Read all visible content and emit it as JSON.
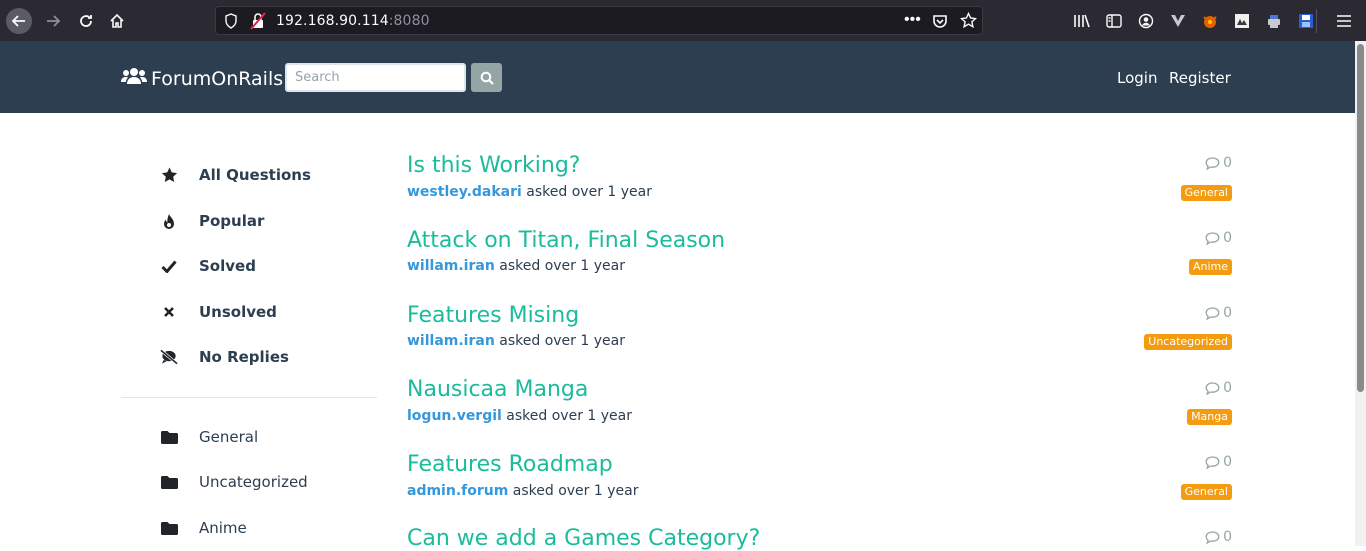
{
  "browser": {
    "url_host": "192.168.90.114",
    "url_port": ":8080"
  },
  "navbar": {
    "brand": "ForumOnRails",
    "search_placeholder": "Search",
    "login": "Login",
    "register": "Register",
    "bg_color": "#2c3e50"
  },
  "sidebar": {
    "filters": [
      {
        "label": "All Questions",
        "icon": "star-icon"
      },
      {
        "label": "Popular",
        "icon": "fire-icon"
      },
      {
        "label": "Solved",
        "icon": "check-icon"
      },
      {
        "label": "Unsolved",
        "icon": "times-icon"
      },
      {
        "label": "No Replies",
        "icon": "comment-slash-icon"
      }
    ],
    "categories": [
      {
        "label": "General",
        "icon": "folder-icon"
      },
      {
        "label": "Uncategorized",
        "icon": "folder-icon"
      },
      {
        "label": "Anime",
        "icon": "folder-icon"
      }
    ]
  },
  "questions": [
    {
      "title": "Is this Working?",
      "user": "westley.dakari",
      "asked": " asked over 1 year",
      "replies": "0",
      "category": "General"
    },
    {
      "title": "Attack on Titan, Final Season",
      "user": "willam.iran",
      "asked": " asked over 1 year",
      "replies": "0",
      "category": "Anime"
    },
    {
      "title": "Features Mising",
      "user": "willam.iran",
      "asked": " asked over 1 year",
      "replies": "0",
      "category": "Uncategorized"
    },
    {
      "title": "Nausicaa Manga",
      "user": "logun.vergil",
      "asked": " asked over 1 year",
      "replies": "0",
      "category": "Manga"
    },
    {
      "title": "Features Roadmap",
      "user": "admin.forum",
      "asked": " asked over 1 year",
      "replies": "0",
      "category": "General"
    },
    {
      "title": "Can we add a Games Category?",
      "user": "",
      "asked": "",
      "replies": "0",
      "category": ""
    }
  ],
  "colors": {
    "accent": "#1abc9c",
    "link": "#3498db",
    "badge": "#f39c12"
  }
}
